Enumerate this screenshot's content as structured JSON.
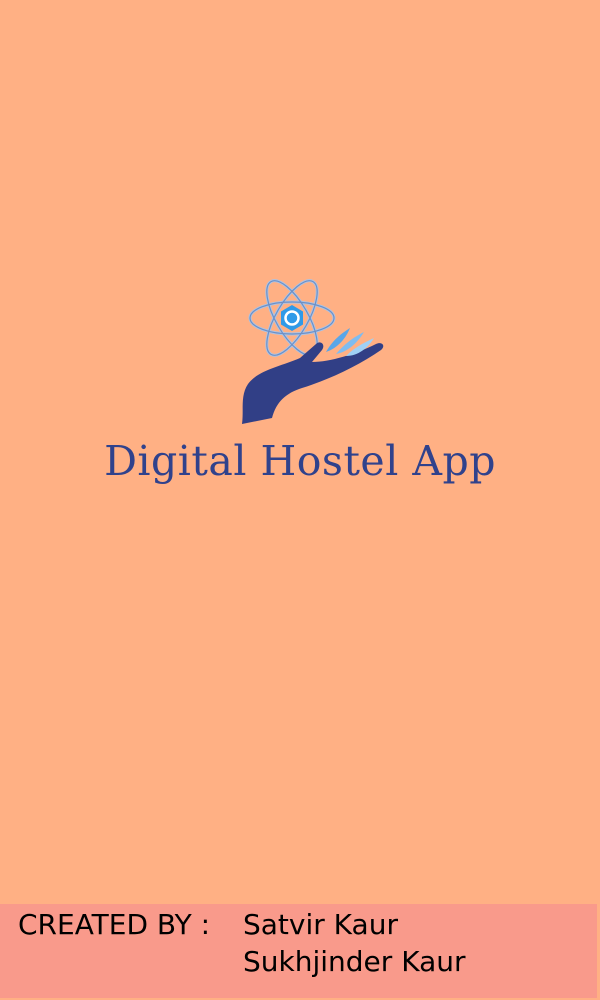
{
  "app": {
    "name": "Digital Hostel App",
    "logo_icon": "atom-hand-icon"
  },
  "footer": {
    "label": "CREATED BY :",
    "names": [
      "Satvir Kaur",
      "Sukhjinder Kaur"
    ]
  },
  "colors": {
    "background": "#ffb084",
    "footer_background": "#f99a8b",
    "brand_blue": "#30428c",
    "accent_blue": "#3ea0e6"
  }
}
